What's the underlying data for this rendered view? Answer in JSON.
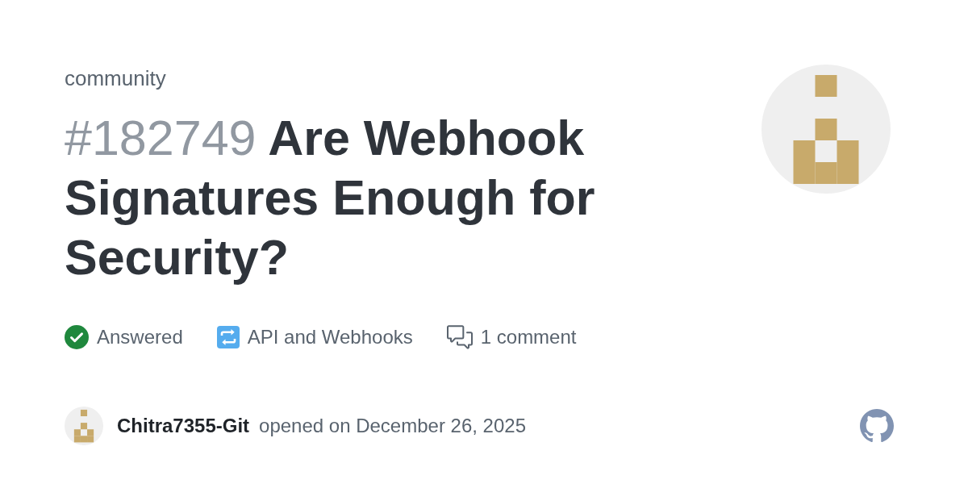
{
  "repository": "community",
  "discussion": {
    "number": "#182749",
    "title": "Are Webhook Signatures Enough for Security?"
  },
  "meta": [
    {
      "kind": "answered",
      "label": "Answered"
    },
    {
      "kind": "category",
      "label": "API and Webhooks"
    },
    {
      "kind": "comments",
      "label": "1 comment"
    }
  ],
  "author": {
    "username": "Chitra7355-Git",
    "action": "opened on December 26, 2025"
  }
}
